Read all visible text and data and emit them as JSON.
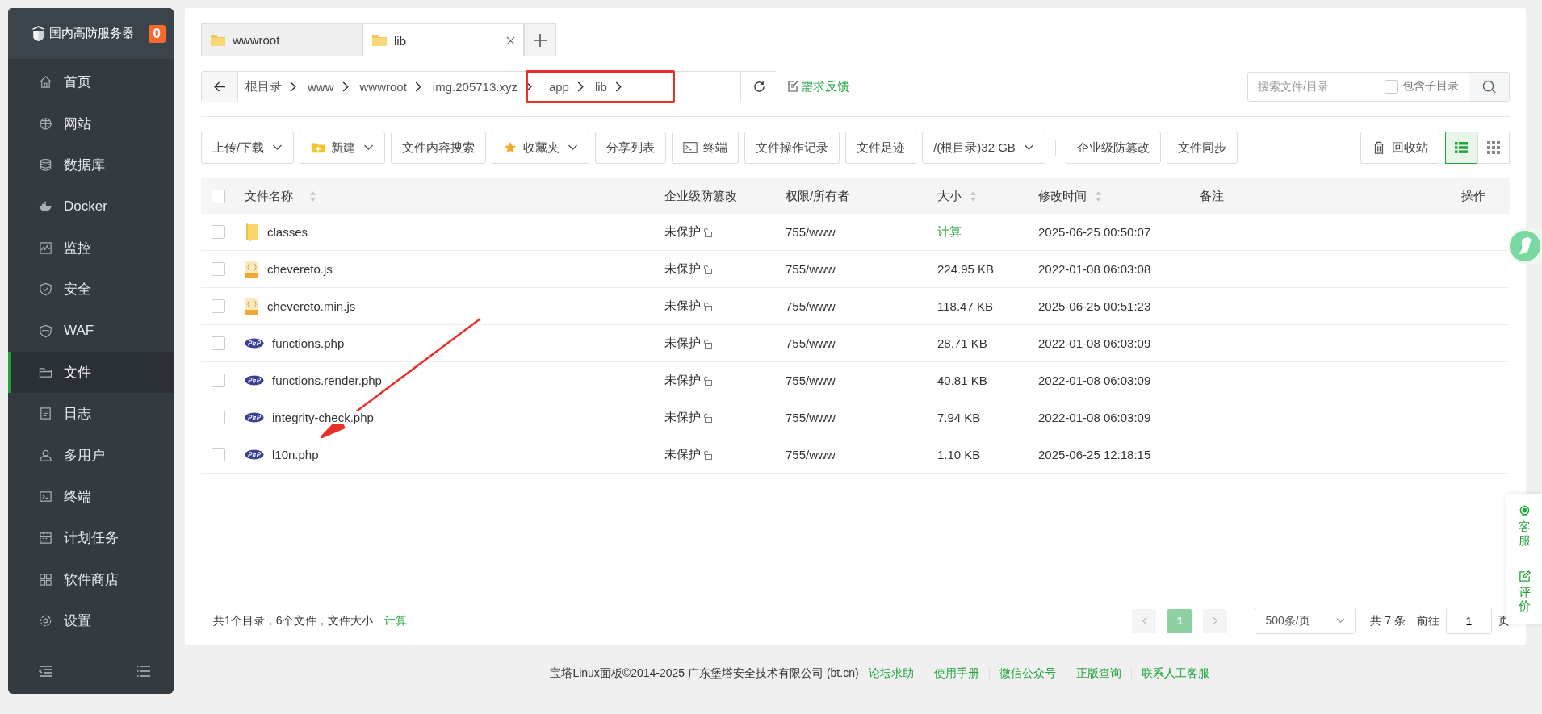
{
  "sidebar": {
    "brand": "国内高防服务器",
    "badge": "0",
    "items": [
      {
        "label": "首页",
        "selected": false
      },
      {
        "label": "网站",
        "selected": false
      },
      {
        "label": "数据库",
        "selected": false
      },
      {
        "label": "Docker",
        "selected": false
      },
      {
        "label": "监控",
        "selected": false
      },
      {
        "label": "安全",
        "selected": false
      },
      {
        "label": "WAF",
        "selected": false
      },
      {
        "label": "文件",
        "selected": true
      },
      {
        "label": "日志",
        "selected": false
      },
      {
        "label": "多用户",
        "selected": false
      },
      {
        "label": "终端",
        "selected": false
      },
      {
        "label": "计划任务",
        "selected": false
      },
      {
        "label": "软件商店",
        "selected": false
      },
      {
        "label": "设置",
        "selected": false
      }
    ]
  },
  "tabs": [
    {
      "label": "wwwroot",
      "selected": false
    },
    {
      "label": "lib",
      "selected": true
    }
  ],
  "breadcrumb": [
    "根目录",
    "www",
    "wwwroot",
    "img.205713.xyz",
    "app",
    "lib"
  ],
  "feedback": "需求反馈",
  "search": {
    "placeholder": "搜索文件/目录",
    "include_sub": {
      "label": "包含子目录",
      "checked": false
    }
  },
  "toolbar": [
    {
      "label": "上传/下载",
      "kind": "dropdown"
    },
    {
      "label": "新建",
      "kind": "new"
    },
    {
      "label": "文件内容搜索",
      "kind": "plain"
    },
    {
      "label": "收藏夹",
      "kind": "star"
    },
    {
      "label": "分享列表",
      "kind": "plain"
    },
    {
      "label": "终端",
      "kind": "terminal"
    },
    {
      "label": "文件操作记录",
      "kind": "plain"
    },
    {
      "label": "文件足迹",
      "kind": "plain"
    },
    {
      "label": "/(根目录)32 GB",
      "kind": "dropdown"
    },
    {
      "label": "企业级防篡改",
      "kind": "plain"
    },
    {
      "label": "文件同步",
      "kind": "plain"
    }
  ],
  "recycle": "回收站",
  "view_modes": [
    {
      "kind": "list",
      "selected": true
    },
    {
      "kind": "grid",
      "selected": false
    }
  ],
  "table": {
    "select_all": {
      "checked": false
    },
    "columns": [
      {
        "label": "文件名称",
        "sortable": true
      },
      {
        "label": "企业级防篡改",
        "sortable": false
      },
      {
        "label": "权限/所有者",
        "sortable": false
      },
      {
        "label": "大小",
        "sortable": true
      },
      {
        "label": "修改时间",
        "sortable": true
      },
      {
        "label": "备注",
        "sortable": false
      },
      {
        "label": "操作",
        "sortable": false
      }
    ],
    "rows": [
      {
        "kind": "folder",
        "name": "classes",
        "protect": "未保护",
        "perm": "755/www",
        "size": "计算",
        "size_link": true,
        "mtime": "2025-06-25 00:50:07",
        "checked": false
      },
      {
        "kind": "js",
        "name": "chevereto.js",
        "protect": "未保护",
        "perm": "755/www",
        "size": "224.95 KB",
        "size_link": false,
        "mtime": "2022-01-08 06:03:08",
        "checked": false
      },
      {
        "kind": "js",
        "name": "chevereto.min.js",
        "protect": "未保护",
        "perm": "755/www",
        "size": "118.47 KB",
        "size_link": false,
        "mtime": "2025-06-25 00:51:23",
        "checked": false
      },
      {
        "kind": "php",
        "name": "functions.php",
        "protect": "未保护",
        "perm": "755/www",
        "size": "28.71 KB",
        "size_link": false,
        "mtime": "2022-01-08 06:03:09",
        "checked": false
      },
      {
        "kind": "php",
        "name": "functions.render.php",
        "protect": "未保护",
        "perm": "755/www",
        "size": "40.81 KB",
        "size_link": false,
        "mtime": "2022-01-08 06:03:09",
        "checked": false
      },
      {
        "kind": "php",
        "name": "integrity-check.php",
        "protect": "未保护",
        "perm": "755/www",
        "size": "7.94 KB",
        "size_link": false,
        "mtime": "2022-01-08 06:03:09",
        "checked": false
      },
      {
        "kind": "php",
        "name": "l10n.php",
        "protect": "未保护",
        "perm": "755/www",
        "size": "1.10 KB",
        "size_link": false,
        "mtime": "2025-06-25 12:18:15",
        "checked": false
      }
    ]
  },
  "summary": {
    "text": "共1个目录，6个文件，文件大小",
    "link": "计算"
  },
  "pagination": {
    "pages": [
      {
        "label": "1",
        "selected": true
      }
    ],
    "page_size": "500条/页",
    "total": "共 7 条",
    "goto_label": "前往",
    "goto_value": "1",
    "page_unit": "页"
  },
  "footer": {
    "copyright": "宝塔Linux面板©2014-2025 广东堡塔安全技术有限公司 (bt.cn)",
    "links": [
      "论坛求助",
      "使用手册",
      "微信公众号",
      "正版查询",
      "联系人工客服"
    ]
  },
  "side_widgets": [
    {
      "label": "客服",
      "kind": "service"
    },
    {
      "label": "评价",
      "kind": "rate"
    }
  ]
}
